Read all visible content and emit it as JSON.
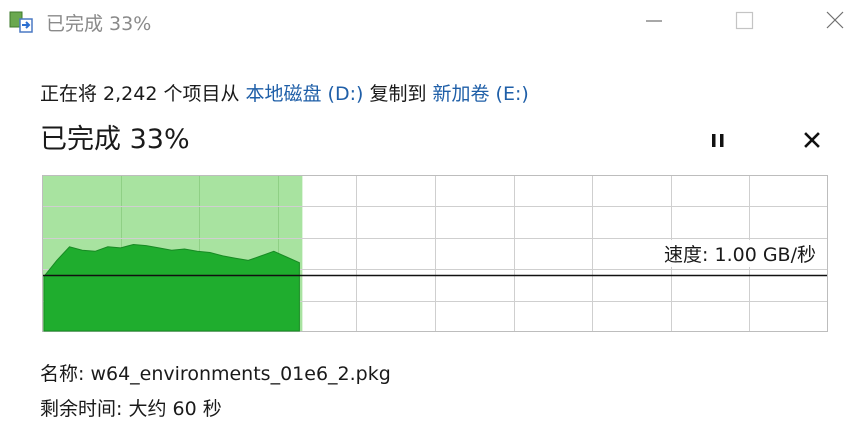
{
  "window": {
    "title": "已完成 33%",
    "icons": {
      "app": "copy-progress-icon",
      "minimize": "minimize-icon",
      "maximize": "maximize-icon",
      "close": "close-icon"
    }
  },
  "operation": {
    "prefix": "正在将 2,242 个项目从 ",
    "source": "本地磁盘 (D:)",
    "middle": " 复制到 ",
    "destination": "新加卷 (E:)",
    "link_color": "#1f5fa8"
  },
  "status": {
    "label": "已完成 33%",
    "percent": 33,
    "pause_icon": "pause-icon",
    "cancel_icon": "cancel-icon"
  },
  "graph": {
    "speed_label": "速度: 1.00 GB/秒",
    "fill_color": "#a8e3a0",
    "area_color": "#1fad2e",
    "grid_color": "#cfcfcf",
    "throughput_profile": [
      0.48,
      0.62,
      0.74,
      0.71,
      0.7,
      0.74,
      0.73,
      0.76,
      0.75,
      0.73,
      0.71,
      0.72,
      0.7,
      0.69,
      0.66,
      0.64,
      0.62,
      0.66,
      0.7,
      0.65,
      0.6
    ]
  },
  "details": {
    "name_label": "名称: ",
    "name_value": "w64_environments_01e6_2.pkg",
    "remaining_label": "剩余时间: ",
    "remaining_value": "大约 60 秒"
  }
}
